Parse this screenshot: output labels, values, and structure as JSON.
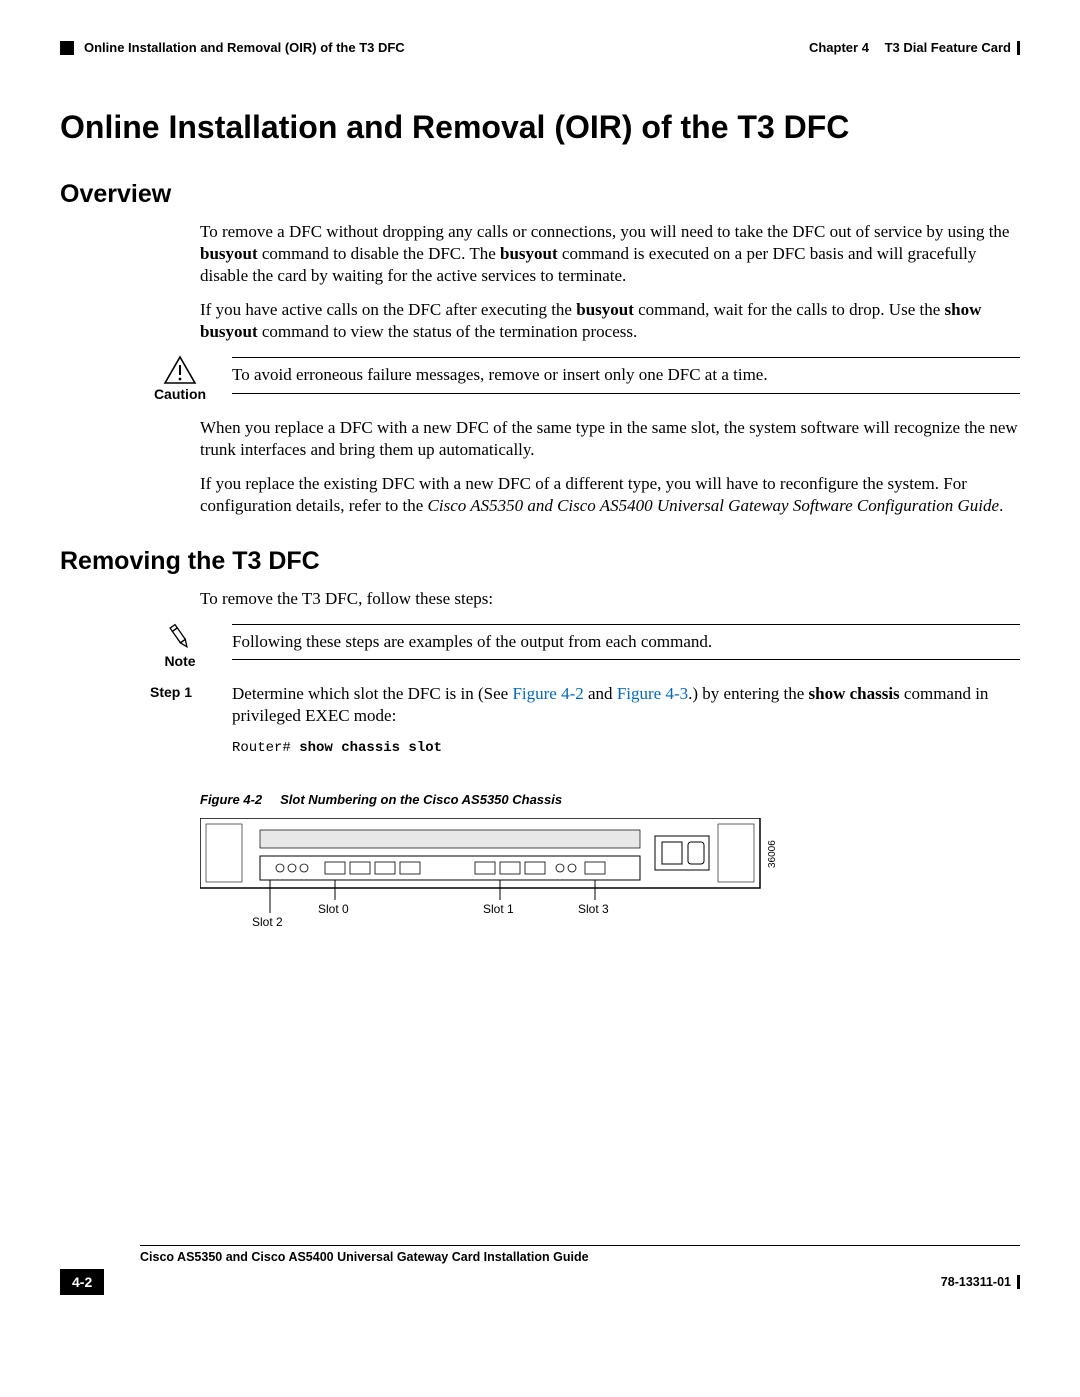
{
  "header": {
    "chapter": "Chapter 4",
    "chapter_title": "T3 Dial Feature Card",
    "breadcrumb": "Online Installation and Removal (OIR) of the T3 DFC"
  },
  "page_title": "Online Installation and Removal (OIR) of the T3 DFC",
  "sections": {
    "overview": {
      "heading": "Overview",
      "p1_a": "To remove a DFC without dropping any calls or connections, you will need to take the DFC out of service by using the ",
      "p1_bold1": "busyout",
      "p1_b": " command to disable the DFC. The ",
      "p1_bold2": "busyout",
      "p1_c": " command is executed on a per DFC basis and will gracefully disable the card by waiting for the active services to terminate.",
      "p2_a": "If you have active calls on the DFC after executing the ",
      "p2_bold1": "busyout",
      "p2_b": " command, wait for the calls to drop. Use the ",
      "p2_bold2": "show busyout",
      "p2_c": " command to view the status of the termination process.",
      "caution_label": "Caution",
      "caution_text": "To avoid erroneous failure messages, remove or insert only one DFC at a time.",
      "p3": "When you replace a DFC with a new DFC of the same type in the same slot, the system software will recognize the new trunk interfaces and bring them up automatically.",
      "p4_a": "If you replace the existing DFC with a new DFC of a different type, you will have to reconfigure the system. For configuration details, refer to the ",
      "p4_italic": "Cisco AS5350 and Cisco AS5400 Universal Gateway Software Configuration Guide",
      "p4_b": "."
    },
    "removing": {
      "heading": "Removing the T3 DFC",
      "intro": "To remove the T3 DFC, follow these steps:",
      "note_label": "Note",
      "note_text": "Following these steps are examples of the output from each command.",
      "step1_label": "Step 1",
      "step1_a": "Determine which slot the DFC is in (See ",
      "step1_link1": "Figure 4-2",
      "step1_mid": " and ",
      "step1_link2": "Figure 4-3",
      "step1_b": ".) by entering the ",
      "step1_bold": "show chassis",
      "step1_c": " command in privileged EXEC mode:",
      "code_prompt": "Router# ",
      "code_cmd": "show chassis slot",
      "fig_num": "Figure 4-2",
      "fig_title": "Slot Numbering on the Cisco AS5350 Chassis",
      "slots": {
        "s0": "Slot 0",
        "s1": "Slot 1",
        "s2": "Slot 2",
        "s3": "Slot 3"
      },
      "fig_id": "36006"
    }
  },
  "footer": {
    "guide": "Cisco AS5350 and Cisco AS5400 Universal Gateway Card Installation Guide",
    "page": "4-2",
    "docnum": "78-13311-01"
  }
}
